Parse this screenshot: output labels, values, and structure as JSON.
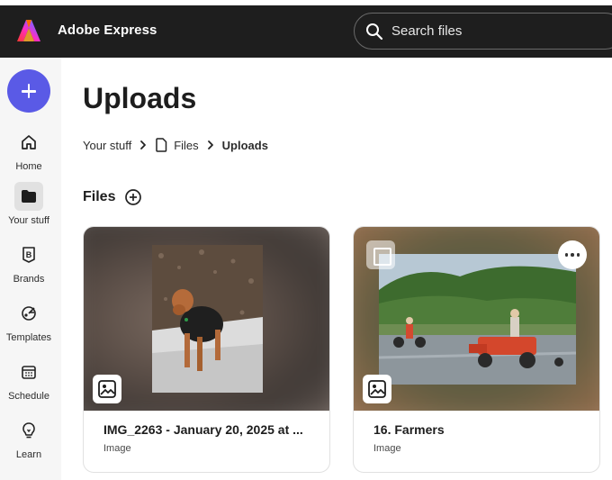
{
  "app": {
    "name": "Adobe Express"
  },
  "search": {
    "placeholder": "Search files"
  },
  "sidebar": {
    "create_icon": "plus-icon",
    "items": [
      {
        "label": "Home",
        "icon": "home-icon"
      },
      {
        "label": "Your stuff",
        "icon": "folder-icon",
        "active": true
      },
      {
        "label": "Brands",
        "icon": "brand-icon"
      },
      {
        "label": "Templates",
        "icon": "templates-icon"
      },
      {
        "label": "Schedule",
        "icon": "calendar-icon"
      },
      {
        "label": "Learn",
        "icon": "lightbulb-icon"
      }
    ]
  },
  "page": {
    "title": "Uploads",
    "breadcrumb": [
      "Your stuff",
      "Files",
      "Uploads"
    ],
    "section_title": "Files"
  },
  "files": [
    {
      "name": "IMG_2263 - January 20, 2025 at ...",
      "type": "Image"
    },
    {
      "name": "16. Farmers",
      "type": "Image"
    }
  ],
  "colors": {
    "accent": "#5a5ae6",
    "topbar": "#1e1e1e"
  }
}
